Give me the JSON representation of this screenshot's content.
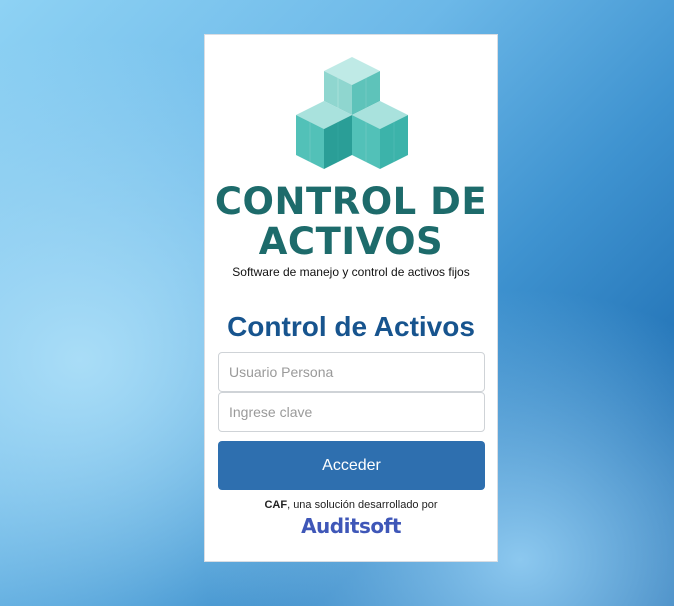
{
  "logo": {
    "title_line1": "CONTROL DE",
    "title_line2": "ACTIVOS",
    "subtitle": "Software de manejo y control de activos fijos",
    "icon": "stacked-cubes-logo",
    "colors": {
      "title": "#1d6b6b",
      "cube_light": "#9fe0db",
      "cube_mid": "#52c1b8",
      "cube_dark": "#2a9e97"
    }
  },
  "form": {
    "heading": "Control de Activos",
    "username_placeholder": "Usuario Persona",
    "username_value": "",
    "password_placeholder": "Ingrese clave",
    "password_value": "",
    "submit_label": "Acceder"
  },
  "footer": {
    "company": "CAF",
    "text": ", una solución desarrollado por",
    "brand": "Auditsoft"
  },
  "colors": {
    "heading": "#17548e",
    "button": "#2e6faf",
    "brand": "#3f57b8"
  }
}
